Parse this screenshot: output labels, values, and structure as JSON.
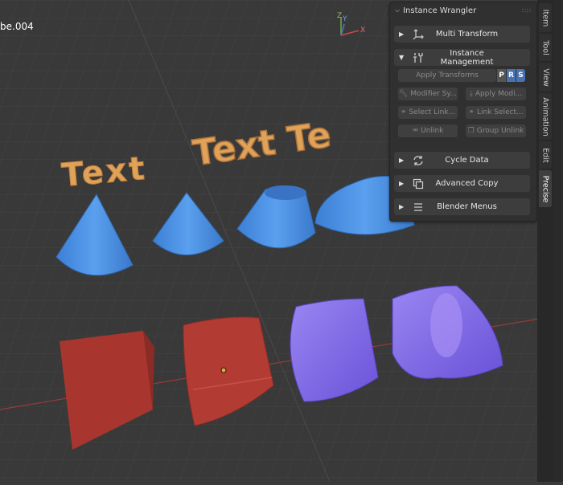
{
  "viewport": {
    "object_label": "be.004",
    "gizmo": {
      "z": "Z",
      "y": "Y",
      "x": "X"
    },
    "scene_text": [
      "Text",
      "Text Te"
    ]
  },
  "panel": {
    "title": "Instance Wrangler",
    "sections": {
      "multi_transform": {
        "label": "Multi Transform",
        "icon": "transform-axes-icon"
      },
      "instance_management": {
        "label": "Instance Management",
        "icon": "tools-icon"
      },
      "cycle_data": {
        "label": "Cycle Data",
        "icon": "cycle-icon"
      },
      "advanced_copy": {
        "label": "Advanced Copy",
        "icon": "copy-icon"
      },
      "blender_menus": {
        "label": "Blender Menus",
        "icon": "menu-icon"
      }
    },
    "buttons": {
      "apply_transforms": "Apply Transforms",
      "axis_p": "P",
      "axis_r": "R",
      "axis_s": "S",
      "modifier_sync": "Modifier Sy...",
      "apply_modifiers": "Apply Modi...",
      "select_linked": "Select Link...",
      "link_select": "Link Select...",
      "unlink": "Unlink",
      "group_unlink": "Group Unlink"
    }
  },
  "tabs": [
    "Item",
    "Tool",
    "View",
    "Animation",
    "Edit",
    "Precise"
  ],
  "active_tab": "Precise",
  "colors": {
    "accent": "#4772b3",
    "text_orange": "#e0a258",
    "cone_blue": "#4a8fe0",
    "cube_red": "#b03a32",
    "purple": "#8a70e8"
  }
}
